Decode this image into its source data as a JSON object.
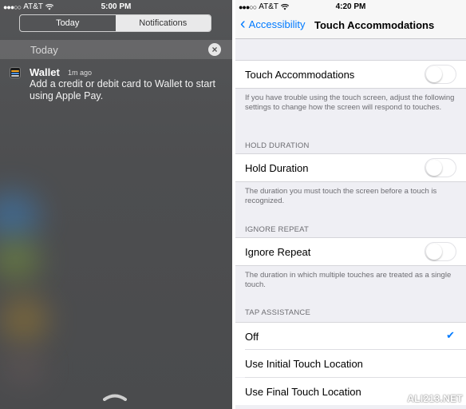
{
  "left": {
    "status": {
      "carrier": "AT&T",
      "time": "5:00 PM"
    },
    "tabs": [
      {
        "label": "Today",
        "active": true
      },
      {
        "label": "Notifications",
        "active": false
      }
    ],
    "section_label": "Today",
    "notification": {
      "app": "Wallet",
      "time_ago": "1m ago",
      "message": "Add a credit or debit card to Wallet to start using Apple Pay."
    }
  },
  "right": {
    "status": {
      "carrier": "AT&T",
      "time": "4:20 PM"
    },
    "nav": {
      "back_label": "Accessibility",
      "title": "Touch Accommodations"
    },
    "touch_accommodations": {
      "label": "Touch Accommodations",
      "enabled": false,
      "footer": "If you have trouble using the touch screen, adjust the following settings to change how the screen will respond to touches."
    },
    "hold_duration": {
      "header": "HOLD DURATION",
      "label": "Hold Duration",
      "enabled": false,
      "footer": "The duration you must touch the screen before a touch is recognized."
    },
    "ignore_repeat": {
      "header": "IGNORE REPEAT",
      "label": "Ignore Repeat",
      "enabled": false,
      "footer": "The duration in which multiple touches are treated as a single touch."
    },
    "tap_assistance": {
      "header": "TAP ASSISTANCE",
      "options": [
        {
          "label": "Off",
          "selected": true
        },
        {
          "label": "Use Initial Touch Location",
          "selected": false
        },
        {
          "label": "Use Final Touch Location",
          "selected": false
        }
      ]
    }
  },
  "watermark": "ALI213.NET",
  "colors": {
    "accent": "#007aff",
    "battery": "#4cd964"
  }
}
